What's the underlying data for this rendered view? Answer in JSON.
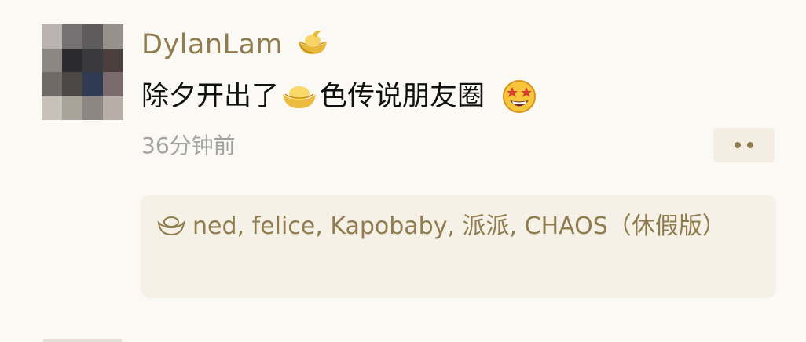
{
  "post": {
    "username": "DylanLam",
    "text_before": "除夕开出了",
    "text_after": "色传说朋友圈",
    "timestamp": "36分钟前"
  },
  "likes": {
    "names": [
      "ned",
      "felice",
      "Kapobaby",
      "派派",
      "CHAOS（休假版）"
    ],
    "separator": ", "
  },
  "icons": {
    "username_badge": "gold-ingot-icon",
    "inline_emoji": "gold-ingot-icon",
    "reaction_emoji": "star-struck-face-icon",
    "like_icon": "gold-ingot-outline-icon",
    "more_button": "more-dots-icon"
  },
  "colors": {
    "background": "#fbf9f4",
    "username": "#8f7c4f",
    "text": "#111111",
    "timestamp": "#a2a2a2",
    "likes_panel": "#f6f1e6",
    "more_button": "#f3ede2"
  }
}
